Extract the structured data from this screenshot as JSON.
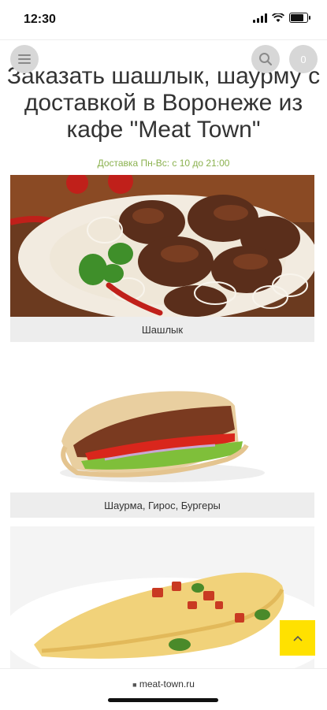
{
  "status_bar": {
    "time": "12:30"
  },
  "header": {
    "cart_count": "0"
  },
  "page": {
    "title": "Заказать шашлык, шаурму с доставкой в Воронеже из кафе \"Meat Town\"",
    "delivery_note": "Доставка Пн-Вс: с 10 до 21:00"
  },
  "categories": [
    {
      "label": "Шашлык",
      "icon": "kebab-photo"
    },
    {
      "label": "Шаурма, Гирос, Бургеры",
      "icon": "shawarma-photo"
    },
    {
      "label": "",
      "icon": "omelette-photo"
    }
  ],
  "footer": {
    "url": "meat-town.ru"
  },
  "colors": {
    "accent_yellow": "#ffe100",
    "note_green": "#8ab14e",
    "label_bg": "#ededed"
  }
}
